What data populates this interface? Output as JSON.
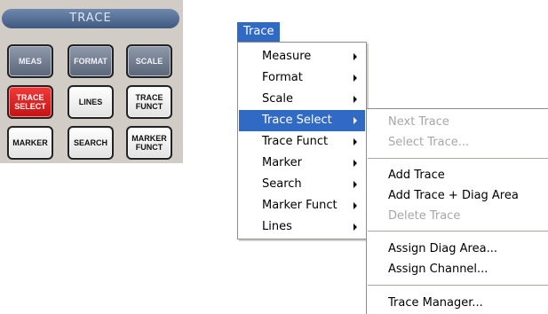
{
  "panel": {
    "title": "TRACE",
    "keys": [
      {
        "label": "MEAS"
      },
      {
        "label": "FORMAT"
      },
      {
        "label": "SCALE"
      },
      {
        "label": "TRACE SELECT"
      },
      {
        "label": "LINES"
      },
      {
        "label": "TRACE FUNCT"
      },
      {
        "label": "MARKER"
      },
      {
        "label": "SEARCH"
      },
      {
        "label": "MARKER FUNCT"
      }
    ]
  },
  "menubar": {
    "title": "Trace"
  },
  "menu": {
    "items": [
      {
        "label": "Measure"
      },
      {
        "label": "Format"
      },
      {
        "label": "Scale"
      },
      {
        "label": "Trace Select"
      },
      {
        "label": "Trace Funct"
      },
      {
        "label": "Marker"
      },
      {
        "label": "Search"
      },
      {
        "label": "Marker Funct"
      },
      {
        "label": "Lines"
      }
    ],
    "highlighted": "Trace Select"
  },
  "submenu": {
    "items": [
      {
        "label": "Next Trace",
        "enabled": false
      },
      {
        "label": "Select Trace...",
        "enabled": false
      },
      {
        "label": "Add Trace",
        "enabled": true
      },
      {
        "label": "Add Trace + Diag Area",
        "enabled": true
      },
      {
        "label": "Delete Trace",
        "enabled": false
      },
      {
        "label": "Assign Diag Area...",
        "enabled": true
      },
      {
        "label": "Assign Channel...",
        "enabled": true
      },
      {
        "label": "Trace Manager...",
        "enabled": true
      }
    ]
  },
  "colors": {
    "highlight": "#316ac5",
    "panel_bg": "#d2ccc6",
    "active_key": "#e02020",
    "disabled_text": "#a7a6aa"
  }
}
